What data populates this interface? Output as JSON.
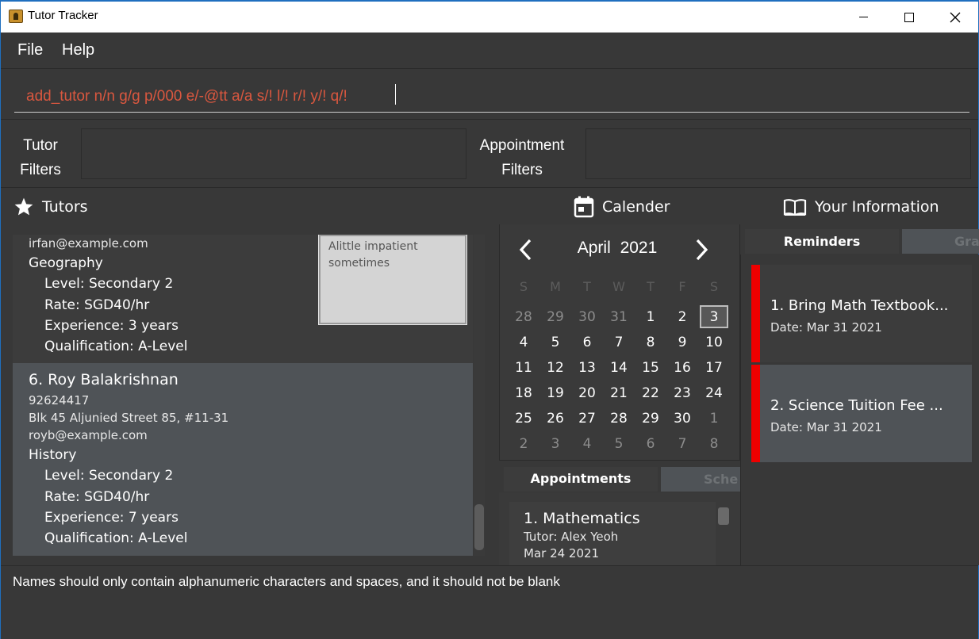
{
  "window": {
    "title": "Tutor Tracker"
  },
  "menu": {
    "file": "File",
    "help": "Help"
  },
  "command": {
    "value": "add_tutor n/n g/g p/000 e/-@tt a/a s/! l/! r/! y/! q/!"
  },
  "filters": {
    "tutor_label_line1": "Tutor",
    "tutor_label_line2": "Filters",
    "appointment_label_line1": "Appointment",
    "appointment_label_line2": "Filters"
  },
  "headers": {
    "tutors": "Tutors",
    "calendar": "Calender",
    "info": "Your Information"
  },
  "tutors": {
    "card5": {
      "email": "irfan@example.com",
      "subject": "Geography",
      "level": "Level: Secondary 2",
      "rate": "Rate: SGD40/hr",
      "experience": "Experience: 3 years",
      "qualification": "Qualification: A-Level",
      "notes_line1": "Alittle impatient",
      "notes_line2": "sometimes"
    },
    "card6": {
      "name": "6.  Roy Balakrishnan",
      "phone": "92624417",
      "address": "Blk 45 Aljunied Street 85, #11-31",
      "email": "royb@example.com",
      "subject": "History",
      "level": "Level: Secondary 2",
      "rate": "Rate: SGD40/hr",
      "experience": "Experience: 7 years",
      "qualification": "Qualification: A-Level"
    }
  },
  "calendar": {
    "month_label": "April 2021",
    "weekdays": [
      "S",
      "M",
      "T",
      "W",
      "T",
      "F",
      "S"
    ],
    "weeks": [
      [
        [
          "28",
          0
        ],
        [
          "29",
          0
        ],
        [
          "30",
          0
        ],
        [
          "31",
          0
        ],
        [
          "1",
          1
        ],
        [
          "2",
          1
        ],
        [
          "3",
          2
        ]
      ],
      [
        [
          "4",
          1
        ],
        [
          "5",
          1
        ],
        [
          "6",
          1
        ],
        [
          "7",
          1
        ],
        [
          "8",
          1
        ],
        [
          "9",
          1
        ],
        [
          "10",
          1
        ]
      ],
      [
        [
          "11",
          1
        ],
        [
          "12",
          1
        ],
        [
          "13",
          1
        ],
        [
          "14",
          1
        ],
        [
          "15",
          1
        ],
        [
          "16",
          1
        ],
        [
          "17",
          1
        ]
      ],
      [
        [
          "18",
          1
        ],
        [
          "19",
          1
        ],
        [
          "20",
          1
        ],
        [
          "21",
          1
        ],
        [
          "22",
          1
        ],
        [
          "23",
          1
        ],
        [
          "24",
          1
        ]
      ],
      [
        [
          "25",
          1
        ],
        [
          "26",
          1
        ],
        [
          "27",
          1
        ],
        [
          "28",
          1
        ],
        [
          "29",
          1
        ],
        [
          "30",
          1
        ],
        [
          "1",
          0
        ]
      ],
      [
        [
          "2",
          0
        ],
        [
          "3",
          0
        ],
        [
          "4",
          0
        ],
        [
          "5",
          0
        ],
        [
          "6",
          0
        ],
        [
          "7",
          0
        ],
        [
          "8",
          0
        ]
      ]
    ]
  },
  "appointments": {
    "tab_appointments": "Appointments",
    "tab_schedules": "Sche",
    "item1_title": "1.  Mathematics",
    "item1_tutor": "Tutor: Alex Yeoh",
    "item1_date": "Mar 24 2021"
  },
  "info": {
    "tab_reminders": "Reminders",
    "tab_grades": "Gra",
    "reminders": [
      {
        "title": "1.  Bring Math Textbook...",
        "date": "Date:  Mar 31 2021"
      },
      {
        "title": "2.  Science Tuition Fee ...",
        "date": "Date:  Mar 31 2021"
      }
    ]
  },
  "result": {
    "message": "Names should only contain alphanumeric characters and spaces, and it should not be blank"
  },
  "colors": {
    "accent_reminder": "#ee0000",
    "command_text": "#d9573f",
    "background": "#383838",
    "selected_card": "#4f5357"
  }
}
